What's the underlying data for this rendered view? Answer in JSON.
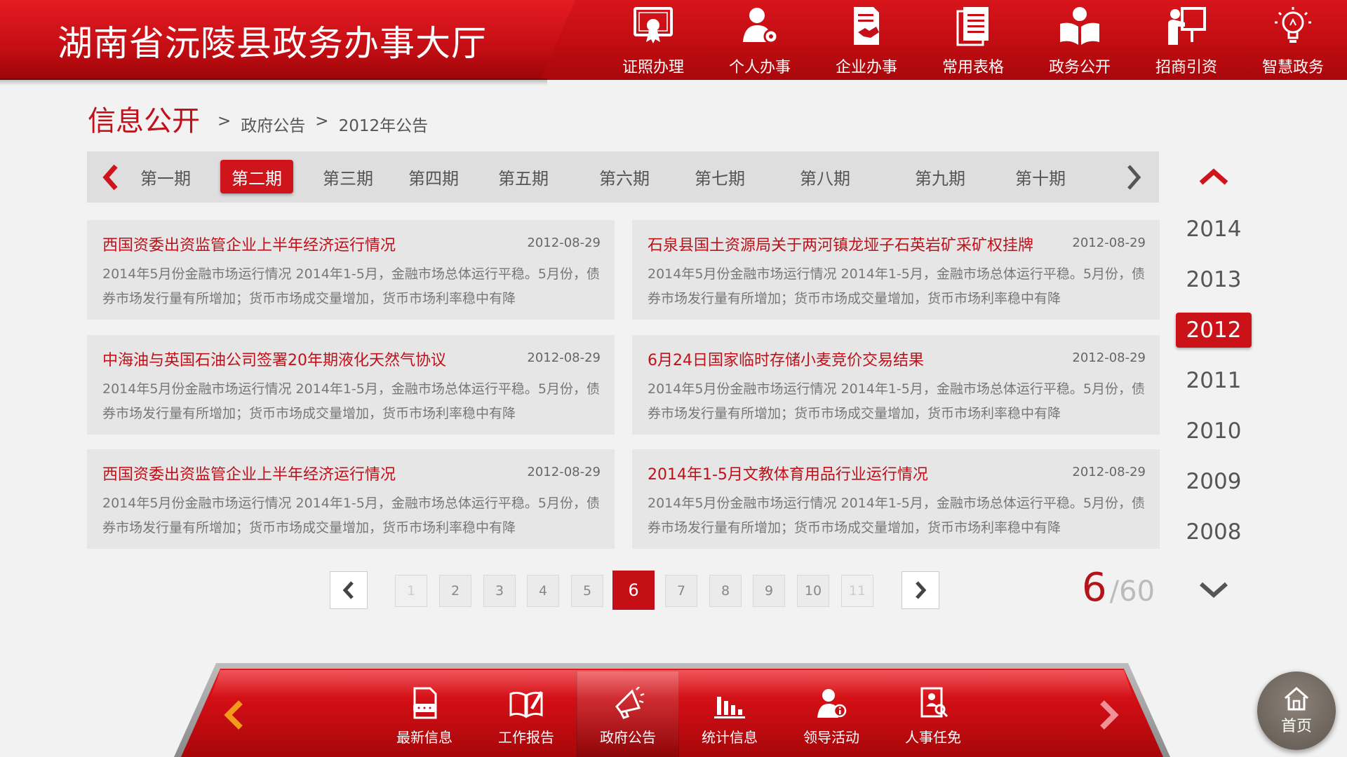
{
  "header": {
    "title": "湖南省沅陵县政务办事大厅",
    "nav": [
      {
        "label": "证照办理",
        "icon": "certificate-icon"
      },
      {
        "label": "个人办事",
        "icon": "person-gear-icon"
      },
      {
        "label": "企业办事",
        "icon": "handshake-document-icon"
      },
      {
        "label": "常用表格",
        "icon": "forms-icon"
      },
      {
        "label": "政务公开",
        "icon": "open-book-icon"
      },
      {
        "label": "招商引资",
        "icon": "presenter-board-icon"
      },
      {
        "label": "智慧政务",
        "icon": "lightbulb-icon"
      }
    ]
  },
  "section": {
    "title": "信息公开",
    "breadcrumb": [
      ">",
      "政府公告",
      ">",
      "2012年公告"
    ]
  },
  "issues": {
    "prev_icon": "chevron-left-icon",
    "next_icon": "chevron-right-icon",
    "tabs": [
      "第一期",
      "第二期",
      "第三期",
      "第四期",
      "第五期",
      "第六期",
      "第七期",
      "第八期",
      "第九期",
      "第十期"
    ],
    "active_index": 1
  },
  "articles": [
    {
      "title": "西国资委出资监管企业上半年经济运行情况",
      "date": "2012-08-29",
      "summary": "2014年5月份金融市场运行情况 2014年1-5月，金融市场总体运行平稳。5月份，债券市场发行量有所增加；货币市场成交量增加，货币市场利率稳中有降"
    },
    {
      "title": "石泉县国土资源局关于两河镇龙垭子石英岩矿采矿权挂牌",
      "date": "2012-08-29",
      "summary": "2014年5月份金融市场运行情况 2014年1-5月，金融市场总体运行平稳。5月份，债券市场发行量有所增加；货币市场成交量增加，货币市场利率稳中有降"
    },
    {
      "title": "中海油与英国石油公司签署20年期液化天然气协议",
      "date": "2012-08-29",
      "summary": "2014年5月份金融市场运行情况 2014年1-5月，金融市场总体运行平稳。5月份，债券市场发行量有所增加；货币市场成交量增加，货币市场利率稳中有降"
    },
    {
      "title": "6月24日国家临时存储小麦竞价交易结果",
      "date": "2012-08-29",
      "summary": "2014年5月份金融市场运行情况 2014年1-5月，金融市场总体运行平稳。5月份，债券市场发行量有所增加；货币市场成交量增加，货币市场利率稳中有降"
    },
    {
      "title": "西国资委出资监管企业上半年经济运行情况",
      "date": "2012-08-29",
      "summary": "2014年5月份金融市场运行情况 2014年1-5月，金融市场总体运行平稳。5月份，债券市场发行量有所增加；货币市场成交量增加，货币市场利率稳中有降"
    },
    {
      "title": "2014年1-5月文教体育用品行业运行情况",
      "date": "2012-08-29",
      "summary": "2014年5月份金融市场运行情况 2014年1-5月，金融市场总体运行平稳。5月份，债券市场发行量有所增加；货币市场成交量增加，货币市场利率稳中有降"
    }
  ],
  "years": {
    "up_icon": "chevron-up-icon",
    "down_icon": "chevron-down-icon",
    "items": [
      "2014",
      "2013",
      "2012",
      "2011",
      "2010",
      "2009",
      "2008"
    ],
    "active": "2012"
  },
  "pagination": {
    "pages": [
      "1",
      "2",
      "3",
      "4",
      "5",
      "6",
      "7",
      "8",
      "9",
      "10",
      "11"
    ],
    "current": "6",
    "slash": "/",
    "total": "60"
  },
  "dock": {
    "items": [
      {
        "label": "最新信息",
        "icon": "new-document-icon"
      },
      {
        "label": "工作报告",
        "icon": "book-pen-icon"
      },
      {
        "label": "政府公告",
        "icon": "megaphone-icon"
      },
      {
        "label": "统计信息",
        "icon": "bar-chart-icon"
      },
      {
        "label": "领导活动",
        "icon": "person-info-icon"
      },
      {
        "label": "人事任免",
        "icon": "document-search-icon"
      }
    ],
    "active_index": 2
  },
  "home": {
    "label": "首页",
    "icon": "home-icon"
  },
  "colors": {
    "primary_red": "#c40f16",
    "title_red": "#c0111a",
    "background": "#f2f2f2"
  }
}
